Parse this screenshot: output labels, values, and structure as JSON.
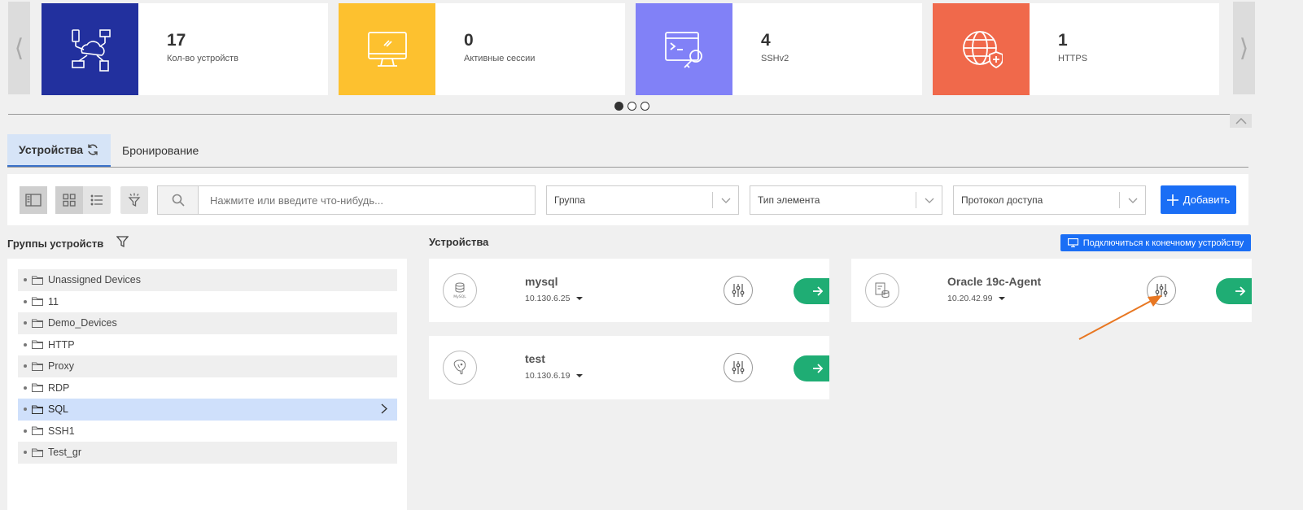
{
  "stats": [
    {
      "value": "17",
      "label": "Кол-во устройств",
      "color": "#22309e",
      "icon": "network-devices-icon"
    },
    {
      "value": "0",
      "label": "Активные сессии",
      "color": "#fdc12f",
      "icon": "monitor-icon"
    },
    {
      "value": "4",
      "label": "SSHv2",
      "color": "#8181f7",
      "icon": "terminal-key-icon"
    },
    {
      "value": "1",
      "label": "HTTPS",
      "color": "#f0694b",
      "icon": "globe-shield-icon"
    }
  ],
  "carousel": {
    "prev": "⟨",
    "next": "⟩",
    "collapse": "︿"
  },
  "tabs": [
    {
      "label": "Устройства",
      "active": true
    },
    {
      "label": "Бронирование",
      "active": false
    }
  ],
  "toolbar": {
    "search_placeholder": "Нажмите или введите что-нибудь...",
    "group_label": "Группа",
    "element_type_label": "Тип элемента",
    "protocol_label": "Протокол доступа",
    "add_label": "Добавить"
  },
  "groups": {
    "title": "Группы устройств",
    "items": [
      {
        "label": "Unassigned Devices"
      },
      {
        "label": "11"
      },
      {
        "label": "Demo_Devices"
      },
      {
        "label": "HTTP"
      },
      {
        "label": "Proxy"
      },
      {
        "label": "RDP"
      },
      {
        "label": "SQL"
      },
      {
        "label": "SSH1"
      },
      {
        "label": "Test_gr"
      }
    ],
    "selected": "SQL"
  },
  "devices": {
    "title": "Устройства",
    "connect_label": "Подключиться к конечному устройству",
    "items": [
      {
        "name": "mysql",
        "ip": "10.130.6.25",
        "icon": "mysql-icon",
        "icon_text": "MySQL"
      },
      {
        "name": "Oracle 19c-Agent",
        "ip": "10.20.42.99",
        "icon": "database-doc-icon"
      },
      {
        "name": "test",
        "ip": "10.130.6.19",
        "icon": "postgres-icon"
      }
    ]
  },
  "colors": {
    "accent": "#1a6ef5",
    "go": "#1fad74",
    "annotation": "#e87722"
  }
}
